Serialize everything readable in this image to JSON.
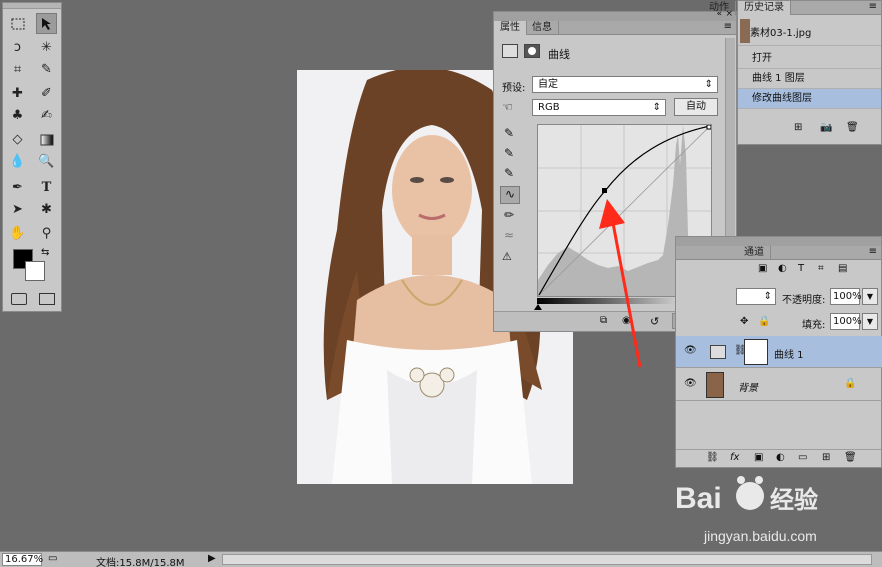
{
  "colors": {
    "canvas_bg": "#6b6b6b",
    "panel_bg": "#c8c8c8",
    "selected_row": "#a8bede",
    "curve_panel": "#e4e4e4",
    "arrow": "#ff2a1a"
  },
  "toolbar": {
    "tools": [
      "marquee-tool",
      "move-tool",
      "lasso-tool",
      "magic-wand-tool",
      "crop-tool",
      "eyedropper-tool",
      "healing-brush-tool",
      "brush-tool",
      "clone-stamp-tool",
      "history-brush-tool",
      "eraser-tool",
      "gradient-tool",
      "blur-tool",
      "dodge-tool",
      "pen-tool",
      "type-tool",
      "path-select-tool",
      "shape-tool",
      "hand-tool",
      "zoom-tool"
    ]
  },
  "properties_panel": {
    "tabs": [
      "属性",
      "信息"
    ],
    "title": "曲线",
    "preset_label": "预设:",
    "preset_value": "自定",
    "channel_value": "RGB",
    "auto_button": "自动"
  },
  "history_panel": {
    "tabs": [
      "动作",
      "历史记录"
    ],
    "snapshot": "素材03-1.jpg",
    "items": [
      "打开",
      "曲线 1 图层",
      "修改曲线图层"
    ]
  },
  "layers_panel": {
    "tab": "通道",
    "opacity_label": "不透明度:",
    "opacity_value": "100%",
    "fill_label": "填充:",
    "fill_value": "100%",
    "layers": [
      {
        "name": "曲线 1",
        "selected": true
      },
      {
        "name": "背景",
        "selected": false
      }
    ]
  },
  "status": {
    "zoom": "16.67%",
    "doc_info": "文档:15.8M/15.8M"
  },
  "watermark": {
    "brand": "Bai du 经验",
    "url": "jingyan.baidu.com"
  }
}
